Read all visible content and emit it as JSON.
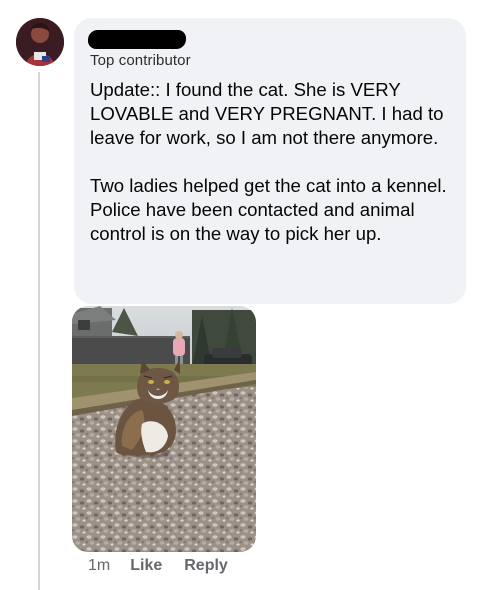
{
  "comment": {
    "author_badge": "Top contributor",
    "paragraphs": [
      "Update:: I found the cat. She is VERY LOVABLE and VERY PREGNANT. I had to leave for work, so I am not there anymore.",
      "Two ladies helped get the cat into a kennel. Police have been contacted and animal control is on the way to pick her up."
    ],
    "timestamp": "1m",
    "like_label": "Like",
    "reply_label": "Reply"
  },
  "colors": {
    "bubble_bg": "#f0f2f5",
    "secondary_text": "#65676b",
    "thread_line": "#d3d5da"
  },
  "image": {
    "subject": "fluffy tabby cat sitting on gravel"
  }
}
